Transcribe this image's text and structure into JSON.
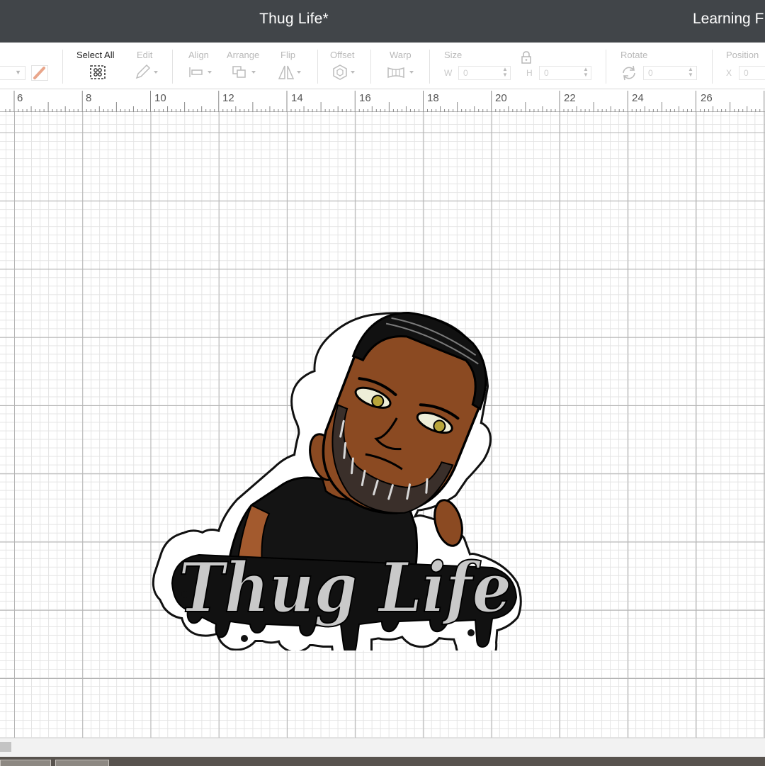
{
  "header": {
    "doc_title": "Thug Life*",
    "learning_link": "Learning F"
  },
  "toolbar": {
    "select_all": "Select All",
    "edit": "Edit",
    "align": "Align",
    "arrange": "Arrange",
    "flip": "Flip",
    "offset": "Offset",
    "warp": "Warp",
    "size": "Size",
    "width_letter": "W",
    "width_value": "0",
    "height_letter": "H",
    "height_value": "0",
    "rotate": "Rotate",
    "rotate_value": "0",
    "position": "Position",
    "position_x_letter": "X",
    "position_x_value": "0"
  },
  "ruler": {
    "labels": [
      "6",
      "8",
      "10",
      "12",
      "14",
      "16",
      "18",
      "20",
      "22",
      "24",
      "26"
    ]
  },
  "sticker": {
    "text": "Thug Life"
  },
  "colors": {
    "titlebar": "#414549",
    "skin": "#8b4a22",
    "shirt": "#141414",
    "lettering": "#c9c9c9"
  }
}
